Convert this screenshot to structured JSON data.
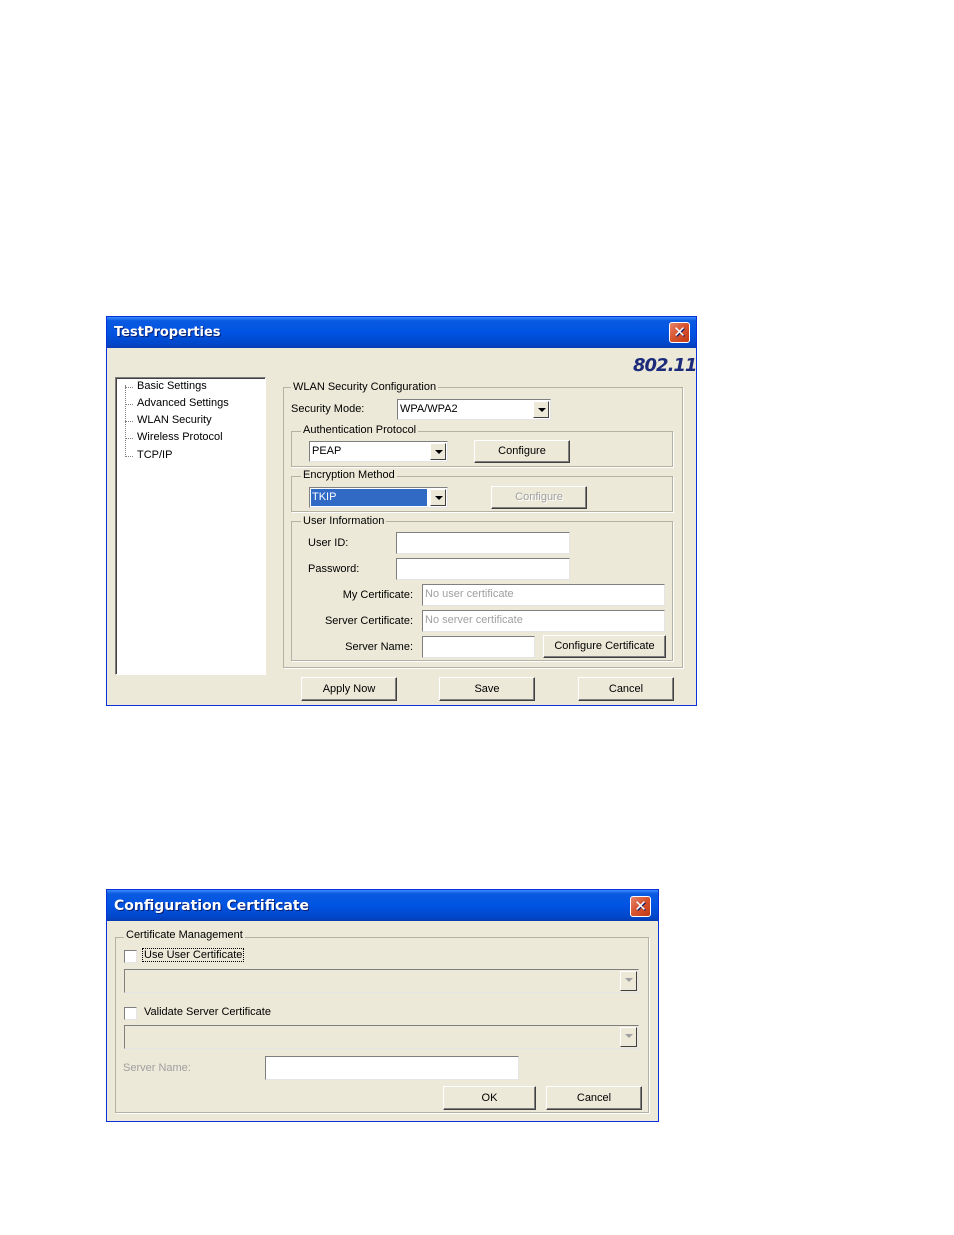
{
  "dialog1": {
    "title": "TestProperties",
    "close_glyph": "✕",
    "logo_text": "802.11",
    "tree": [
      "Basic Settings",
      "Advanced Settings",
      "WLAN Security",
      "Wireless Protocol",
      "TCP/IP"
    ],
    "wlan_group_label": "WLAN Security Configuration",
    "security_mode_label": "Security Mode:",
    "security_mode_value": "WPA/WPA2",
    "auth_group_label": "Authentication Protocol",
    "auth_value": "PEAP",
    "auth_configure_label": "Configure",
    "enc_group_label": "Encryption Method",
    "enc_value": "TKIP",
    "enc_configure_label": "Configure",
    "user_group_label": "User Information",
    "user_id_label": "User ID:",
    "user_id_value": "",
    "password_label": "Password:",
    "password_value": "",
    "my_cert_label": "My Certificate:",
    "my_cert_value": "No user certificate",
    "server_cert_label": "Server Certificate:",
    "server_cert_value": "No server certificate",
    "server_name_label": "Server Name:",
    "server_name_value": "",
    "configure_cert_label": "Configure Certificate",
    "apply_label": "Apply Now",
    "save_label": "Save",
    "cancel_label": "Cancel"
  },
  "dialog2": {
    "title": "Configuration Certificate",
    "close_glyph": "✕",
    "group_label": "Certificate Management",
    "use_user_cert_label": "Use User Certificate",
    "use_user_cert_checked": false,
    "user_cert_value": "",
    "validate_server_cert_label": "Validate Server Certificate",
    "validate_server_cert_checked": false,
    "server_cert_value": "",
    "server_name_label": "Server Name:",
    "server_name_value": "",
    "ok_label": "OK",
    "cancel_label": "Cancel"
  },
  "colors": {
    "titlebar": "#0054e3",
    "window_bg": "#ece9d8",
    "selection": "#316ac5",
    "logo": "#1c2b7a",
    "close": "#d5512c"
  }
}
